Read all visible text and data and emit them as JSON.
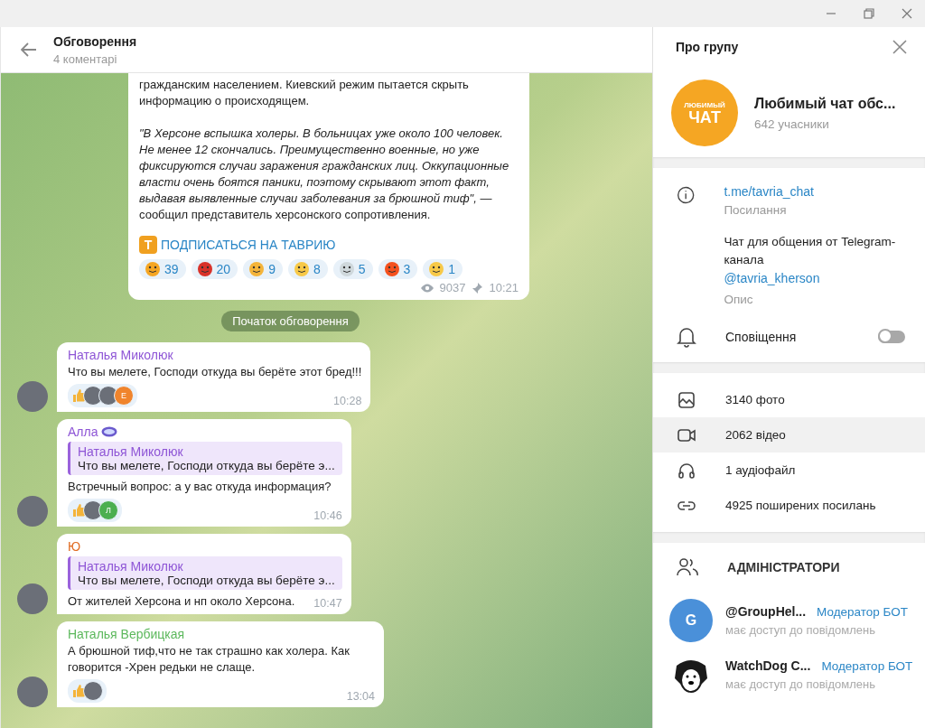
{
  "window_controls": [
    {
      "kind": "minimize"
    },
    {
      "kind": "restore"
    },
    {
      "kind": "close"
    }
  ],
  "chat": {
    "title": "Обговорення",
    "subtitle": "4 коментарі",
    "post": {
      "paragraphs": [
        "гражданским населением. Киевский режим пытается скрыть информацию о происходящем.",
        "*\"В Херсоне вспышка холеры. В больницах уже около 100 человек. Не менее 12 скончались. Преимущественно военные, но уже фиксируются случаи заражения гражданских лиц. Оккупационные власти очень боятся паники, поэтому скрывают этот факт, выдавая выявленные случаи заболевания за брюшной тиф\",* — сообщил представитель херсонского сопротивления."
      ],
      "link": "ПОДПИСАТЬСЯ НА ТАВРИЮ",
      "link_badge": "T",
      "reactions": [
        {
          "kind": "pray",
          "count": "39"
        },
        {
          "kind": "angry",
          "count": "20"
        },
        {
          "kind": "thumbs",
          "count": "9"
        },
        {
          "kind": "grin",
          "count": "8"
        },
        {
          "kind": "dove",
          "count": "5"
        },
        {
          "kind": "fire",
          "count": "3"
        },
        {
          "kind": "cry",
          "count": "1"
        }
      ],
      "views": "9037",
      "time": "10:21"
    },
    "divider": "Початок обговорення",
    "comments": [
      {
        "author": "Наталья Миколюк",
        "color": "#8e55d6",
        "badge": false,
        "text": "Что вы мелете, Господи откуда вы берёте этот бред!!!",
        "reactors": [
          {
            "kind": "photo"
          },
          {
            "kind": "photo"
          },
          {
            "kind": "letter",
            "letter": "Е",
            "color": "#f0842c"
          }
        ],
        "time": "10:28"
      },
      {
        "author": "Алла",
        "color": "#8e55d6",
        "badge": true,
        "reply": {
          "author": "Наталья Миколюк",
          "text": "Что вы мелете, Господи откуда вы берёте э..."
        },
        "text": "Встречный вопрос: а у вас откуда информация?",
        "reactors": [
          {
            "kind": "photo"
          },
          {
            "kind": "letter",
            "letter": "Л",
            "color": "#4caf50"
          }
        ],
        "time": "10:46"
      },
      {
        "author": "Ю",
        "color": "#e06a20",
        "badge": false,
        "reply": {
          "author": "Наталья Миколюк",
          "text": "Что вы мелете, Господи откуда вы берёте э..."
        },
        "text": "От жителей Херсона и нп около Херсона.",
        "time": "10:47"
      },
      {
        "author": "Наталья Вербицкая",
        "color": "#5cb85c",
        "badge": false,
        "text": "А брюшной тиф,что не так страшно как холера. Как говорится -Хрен редьки не слаще.",
        "reactors": [
          {
            "kind": "photo"
          }
        ],
        "time": "13:04"
      }
    ]
  },
  "panel": {
    "title": "Про групу",
    "group": {
      "avatar_text": [
        "ЛЮБИМЫЙ",
        "ЧАТ"
      ],
      "name": "Любимый чат обс...",
      "members": "642 учасники"
    },
    "link": "t.me/tavria_chat",
    "link_label": "Посилання",
    "description": "Чат для общения от Telegram-канала",
    "description_link": "@tavria_kherson",
    "description_label": "Опис",
    "notifications": {
      "label": "Сповіщення",
      "on": false
    },
    "media": [
      {
        "kind": "photo",
        "label": "3140 фото",
        "highlighted": false
      },
      {
        "kind": "video",
        "label": "2062 відео",
        "highlighted": true
      },
      {
        "kind": "audio",
        "label": "1 аудіофайл",
        "highlighted": false
      },
      {
        "kind": "link",
        "label": "4925 поширених посилань",
        "highlighted": false
      }
    ],
    "admins_title": "АДМІНІСТРАТОРИ",
    "admins": [
      {
        "kind": "letter",
        "letter": "G",
        "name": "@GroupHel...",
        "role": "Модератор БОТ",
        "access": "має доступ до повідомлень"
      },
      {
        "kind": "dog",
        "name": "WatchDog C...",
        "role": "Модератор БОТ",
        "access": "має доступ до повідомлень"
      }
    ]
  }
}
